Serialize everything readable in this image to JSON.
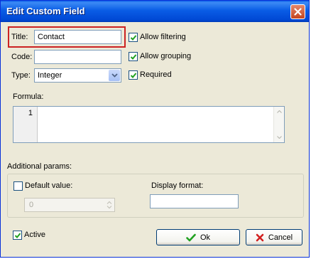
{
  "window": {
    "title": "Edit Custom Field"
  },
  "form": {
    "title_label": "Title:",
    "title_value": "Contact",
    "code_label": "Code:",
    "code_value": "",
    "type_label": "Type:",
    "type_value": "Integer",
    "allow_filtering_label": "Allow filtering",
    "allow_filtering_checked": true,
    "allow_grouping_label": "Allow grouping",
    "allow_grouping_checked": true,
    "required_label": "Required",
    "required_checked": true,
    "formula_label": "Formula:",
    "formula_line_number": "1",
    "formula_text": ""
  },
  "params": {
    "section_label": "Additional params:",
    "default_value_label": "Default value:",
    "default_value_checked": false,
    "default_value": "0",
    "display_format_label": "Display format:",
    "display_format_value": ""
  },
  "footer": {
    "active_label": "Active",
    "active_checked": true,
    "ok_label": "Ok",
    "cancel_label": "Cancel"
  },
  "colors": {
    "highlight": "#cc2222",
    "titlebar": "#0a5ce8",
    "check": "#21a121",
    "cancel_x": "#d22020"
  },
  "icons": [
    "close-icon",
    "check-icon",
    "combo-arrow-icon",
    "ok-check-icon",
    "cancel-x-icon"
  ]
}
